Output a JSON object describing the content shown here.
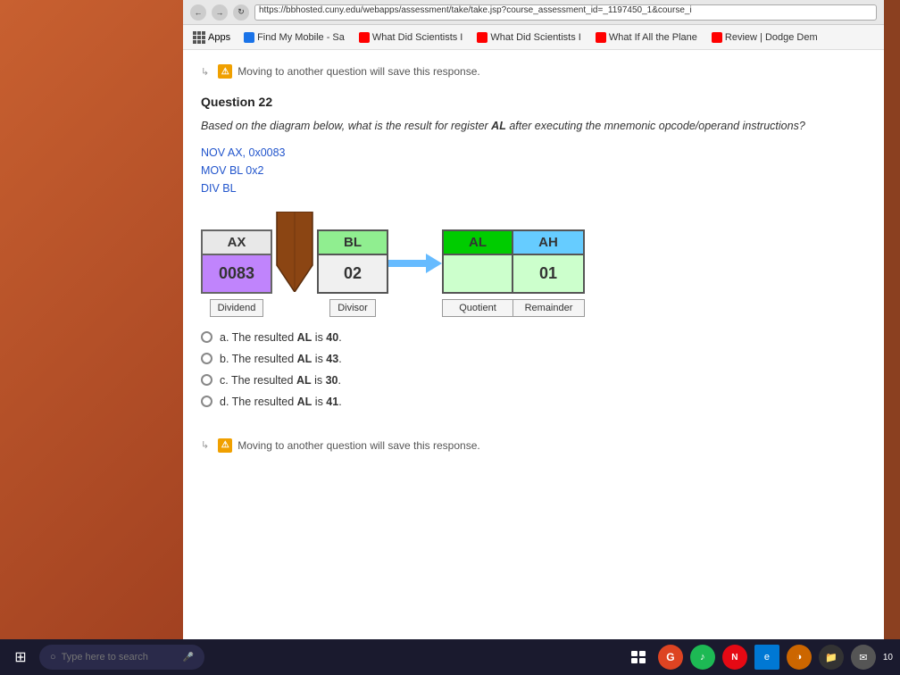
{
  "browser": {
    "address_bar": {
      "url": "https://bbhosted.cuny.edu/webapps/assessment/take/take.jsp?course_assessment_id=_1197450_1&course_i"
    },
    "bookmarks": [
      {
        "label": "Apps",
        "type": "apps"
      },
      {
        "label": "Find My Mobile - Sa",
        "color": "#1a73e8"
      },
      {
        "label": "What Did Scientists I",
        "color": "#ff0000"
      },
      {
        "label": "What Did Scientists I",
        "color": "#ff0000"
      },
      {
        "label": "What If All the Plane",
        "color": "#ff0000"
      },
      {
        "label": "Review | Dodge Dem",
        "color": "#ff0000"
      }
    ]
  },
  "page": {
    "warning_top": "Moving to another question will save this response.",
    "question_number": "Question 22",
    "question_text": "Based on the diagram below, what is the result for register AL after executing the mnemonic opcode/operand instructions?",
    "code_lines": [
      "NOV AX, 0x0083",
      "MOV BL 0x2",
      "DIV BL"
    ],
    "diagram": {
      "ax_label": "AX",
      "ax_value": "0083",
      "ax_caption": "Dividend",
      "bl_label": "BL",
      "bl_value": "02",
      "bl_caption": "Divisor",
      "al_label": "AL",
      "ah_label": "AH",
      "al_value": "",
      "ah_value": "01",
      "al_caption": "Quotient",
      "ah_caption": "Remainder"
    },
    "options": [
      {
        "id": "a",
        "text": "The resulted AL is 40."
      },
      {
        "id": "b",
        "text": "The resulted AL is 43."
      },
      {
        "id": "c",
        "text": "The resulted AL is 30."
      },
      {
        "id": "d",
        "text": "The resulted AL is 41."
      }
    ],
    "warning_bottom": "Moving to another question will save this response."
  },
  "taskbar": {
    "search_placeholder": "Type here to search",
    "time": "10"
  }
}
